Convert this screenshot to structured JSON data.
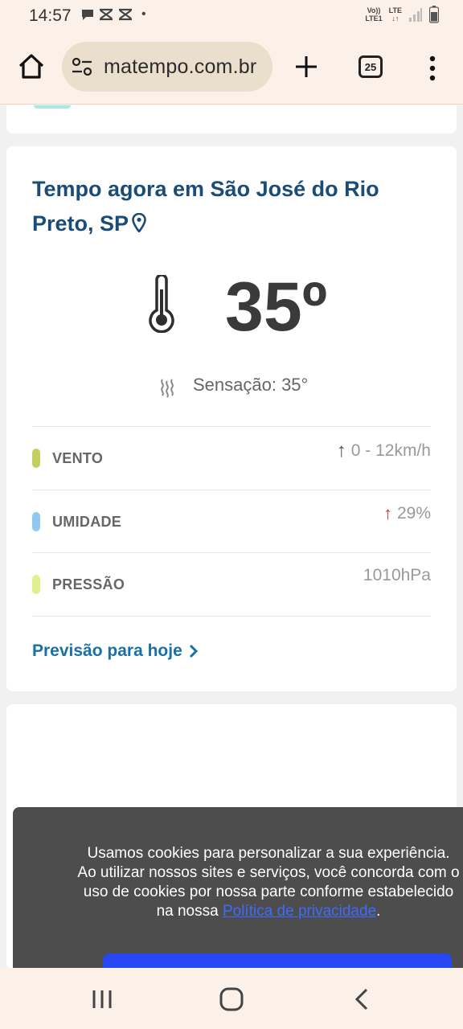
{
  "status_bar": {
    "time": "14:57",
    "dot": "•",
    "volte_line1": "Vo))",
    "volte_line2": "LTE1",
    "lte_line1": "LTE",
    "lte_line2": "↓↑",
    "notification_icons": [
      "chat-bubble-icon",
      "capcut-icon",
      "capcut-icon"
    ],
    "system_icons": [
      "volte-icon",
      "lte-icon",
      "signal-icon",
      "battery-icon"
    ]
  },
  "browser": {
    "url": "matempo.com.br",
    "tab_count": "25",
    "icons": [
      "home-icon",
      "site-settings-icon",
      "plus-icon",
      "tabs-icon",
      "kebab-menu-icon"
    ]
  },
  "weather": {
    "title": "Tempo agora em São José do Rio Preto, SP",
    "temperature": "35º",
    "feels_like": "Sensação: 35°",
    "rows": [
      {
        "label": "VENTO",
        "value": "0 - 12km/h",
        "dot_color": "#c2d15e",
        "arrow": "↑",
        "arrow_color": "#666666"
      },
      {
        "label": "UMIDADE",
        "value": "29%",
        "dot_color": "#8ec8f3",
        "arrow": "↑",
        "arrow_color": "#e0342b"
      },
      {
        "label": "PRESSÃO",
        "value": "1010hPa",
        "dot_color": "#e2ef8f",
        "arrow": "",
        "arrow_color": ""
      }
    ],
    "forecast_link": "Previsão para hoje",
    "colors": {
      "title": "#1a4c78",
      "link": "#1a6fa8"
    }
  },
  "cookie_banner": {
    "text": "Usamos cookies para personalizar a sua experiência. Ao utilizar nossos sites e serviços, você concorda com o uso de cookies por nossa parte conforme estabelecido na nossa",
    "link_text": "Política de privacidade",
    "period": ".",
    "button_color": "#2747f5"
  },
  "nav_bar": {
    "icons": [
      "recent-apps-icon",
      "home-circle-icon",
      "back-icon"
    ]
  }
}
